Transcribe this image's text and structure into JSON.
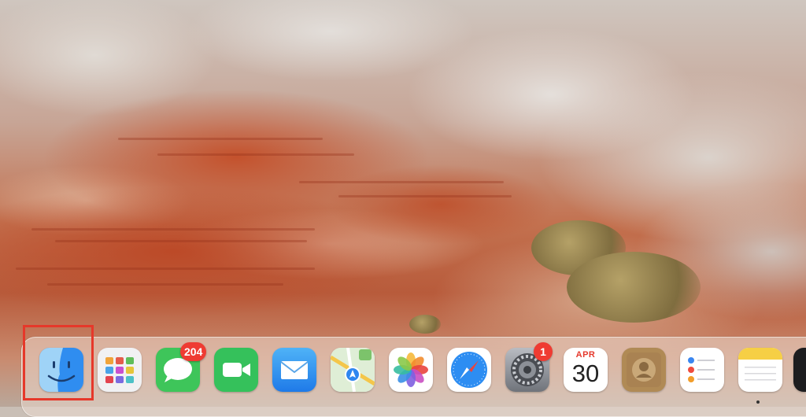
{
  "dock": {
    "items": [
      {
        "name": "finder-app",
        "icon": "finder-icon",
        "highlighted": true
      },
      {
        "name": "launchpad-app",
        "icon": "launchpad-icon"
      },
      {
        "name": "messages-app",
        "icon": "messages-icon",
        "badge": "204"
      },
      {
        "name": "facetime-app",
        "icon": "facetime-icon"
      },
      {
        "name": "mail-app",
        "icon": "mail-icon"
      },
      {
        "name": "maps-app",
        "icon": "maps-icon"
      },
      {
        "name": "photos-app",
        "icon": "photos-icon"
      },
      {
        "name": "safari-app",
        "icon": "safari-icon"
      },
      {
        "name": "system-settings-app",
        "icon": "gear-icon",
        "badge": "1"
      },
      {
        "name": "calendar-app",
        "icon": "calendar-icon",
        "month": "APR",
        "day": "30"
      },
      {
        "name": "contacts-app",
        "icon": "contacts-icon"
      },
      {
        "name": "reminders-app",
        "icon": "reminders-icon"
      },
      {
        "name": "notes-app",
        "icon": "notes-icon"
      }
    ]
  },
  "colors": {
    "highlight": "#e6382a",
    "badge": "#ef3b32",
    "calendar_month": "#e5392d"
  }
}
